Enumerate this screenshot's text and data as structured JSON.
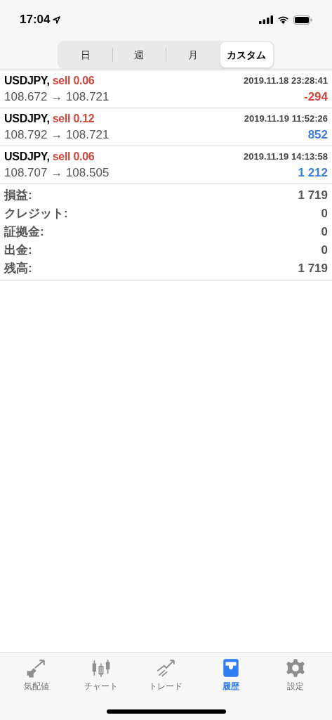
{
  "status_bar": {
    "time": "17:04"
  },
  "segments": [
    {
      "label": "日",
      "selected": false
    },
    {
      "label": "週",
      "selected": false
    },
    {
      "label": "月",
      "selected": false
    },
    {
      "label": "カスタム",
      "selected": true
    }
  ],
  "deals": [
    {
      "symbol": "USDJPY,",
      "action": "sell 0.06",
      "time": "2019.11.18 23:28:41",
      "prices": "108.672 → 108.721",
      "profit": "-294",
      "color": "#d0463b"
    },
    {
      "symbol": "USDJPY,",
      "action": "sell 0.12",
      "time": "2019.11.19 11:52:26",
      "prices": "108.792 → 108.721",
      "profit": "852",
      "color": "#3b7ee0"
    },
    {
      "symbol": "USDJPY,",
      "action": "sell 0.06",
      "time": "2019.11.19 14:13:58",
      "prices": "108.707 → 108.505",
      "profit": "1 212",
      "color": "#3b7ee0"
    }
  ],
  "summary": [
    {
      "label": "損益:",
      "value": "1 719"
    },
    {
      "label": "クレジット:",
      "value": "0"
    },
    {
      "label": "証拠金:",
      "value": "0"
    },
    {
      "label": "出金:",
      "value": "0"
    },
    {
      "label": "残高:",
      "value": "1 719"
    }
  ],
  "tab_bar": [
    {
      "kind": "quotes",
      "label": "気配値",
      "selected": false
    },
    {
      "kind": "chart",
      "label": "チャート",
      "selected": false
    },
    {
      "kind": "trade",
      "label": "トレード",
      "selected": false
    },
    {
      "kind": "history",
      "label": "履歴",
      "selected": true
    },
    {
      "kind": "settings",
      "label": "設定",
      "selected": false
    }
  ]
}
